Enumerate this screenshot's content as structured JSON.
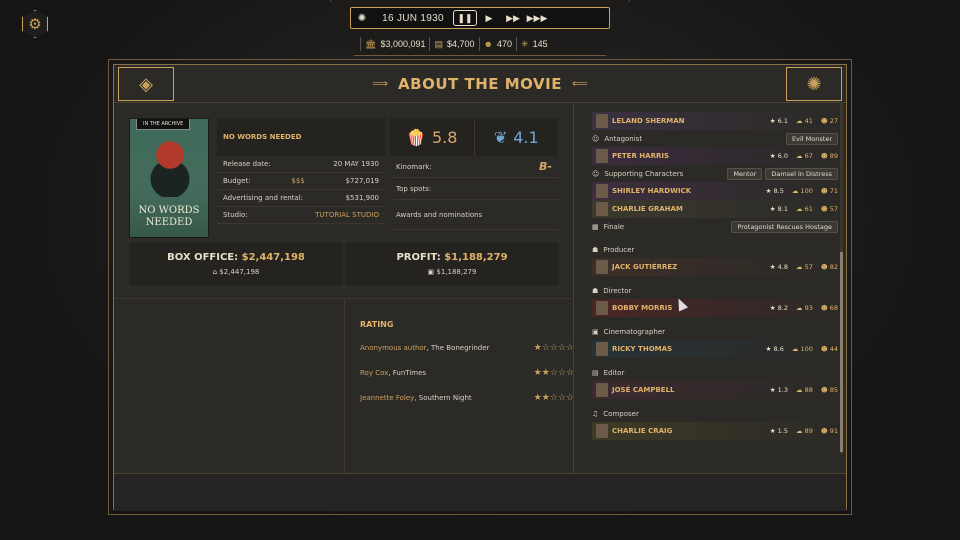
{
  "topbar": {
    "date": "16 JUN 1930",
    "money": "$3,000,091",
    "cash": "$4,700",
    "fans": "470",
    "stars": "145"
  },
  "header": {
    "title": "ABOUT THE MOVIE"
  },
  "movie": {
    "archive_tag": "IN THE ARCHIVE",
    "poster_title": "NO WORDS NEEDED",
    "name": "NO WORDS NEEDED",
    "release_label": "Release date:",
    "release": "20 MAY 1930",
    "budget_label": "Budget:",
    "budget_symbol": "$$$",
    "budget": "$727,019",
    "ads_label": "Advertising and rental:",
    "ads": "$531,900",
    "studio_label": "Studio:",
    "studio": "TUTORIAL STUDIO",
    "popularity": "5.8",
    "critics": "4.1",
    "kinomark_label": "Kinomark:",
    "kinomark": "B-",
    "topspots_label": "Top spots:",
    "awards_label": "Awards and nominations",
    "box_office_label": "BOX OFFICE:",
    "box_office": "$2,447,198",
    "box_office_small": "$2,447,198",
    "profit_label": "PROFIT:",
    "profit": "$1,188,279",
    "profit_small": "$1,188,279"
  },
  "rating": {
    "title": "RATING",
    "reviews": [
      {
        "author": "Anonymous author",
        "outlet": ", The Bonegrinder",
        "stars": "★☆☆☆☆"
      },
      {
        "author": "Roy Cox",
        "outlet": ", FunTimes",
        "stars": "★★☆☆☆"
      },
      {
        "author": "Jeannette Foley",
        "outlet": ", Southern Night",
        "stars": "★★☆☆☆"
      }
    ]
  },
  "crew": {
    "p0": {
      "name": "LELAND SHERMAN",
      "s": "6.1",
      "l": "41",
      "m": "27"
    },
    "antagonist_label": "Antagonist",
    "antagonist_role": "Evil Monster",
    "p1": {
      "name": "PETER HARRIS",
      "s": "6.0",
      "l": "67",
      "m": "89"
    },
    "supporting_label": "Supporting Characters",
    "support_role1": "Mentor",
    "support_role2": "Damsel in Distress",
    "p2": {
      "name": "SHIRLEY HARDWICK",
      "s": "8.5",
      "l": "100",
      "m": "71"
    },
    "p3": {
      "name": "CHARLIE GRAHAM",
      "s": "8.1",
      "l": "61",
      "m": "57"
    },
    "finale_label": "Finale",
    "finale_role": "Protagonist Rescues Hostage",
    "producer_label": "Producer",
    "p4": {
      "name": "JACK GUTIÉRREZ",
      "s": "4.8",
      "l": "57",
      "m": "82"
    },
    "director_label": "Director",
    "p5": {
      "name": "BOBBY MORRIS",
      "s": "8.2",
      "l": "93",
      "m": "68"
    },
    "cinematographer_label": "Cinematographer",
    "p6": {
      "name": "RICKY THOMAS",
      "s": "8.6",
      "l": "100",
      "m": "44"
    },
    "editor_label": "Editor",
    "p7": {
      "name": "JOSÉ CAMPBELL",
      "s": "1.3",
      "l": "88",
      "m": "85"
    },
    "composer_label": "Composer",
    "p8": {
      "name": "CHARLIE CRAIG",
      "s": "1.5",
      "l": "89",
      "m": "91"
    }
  }
}
